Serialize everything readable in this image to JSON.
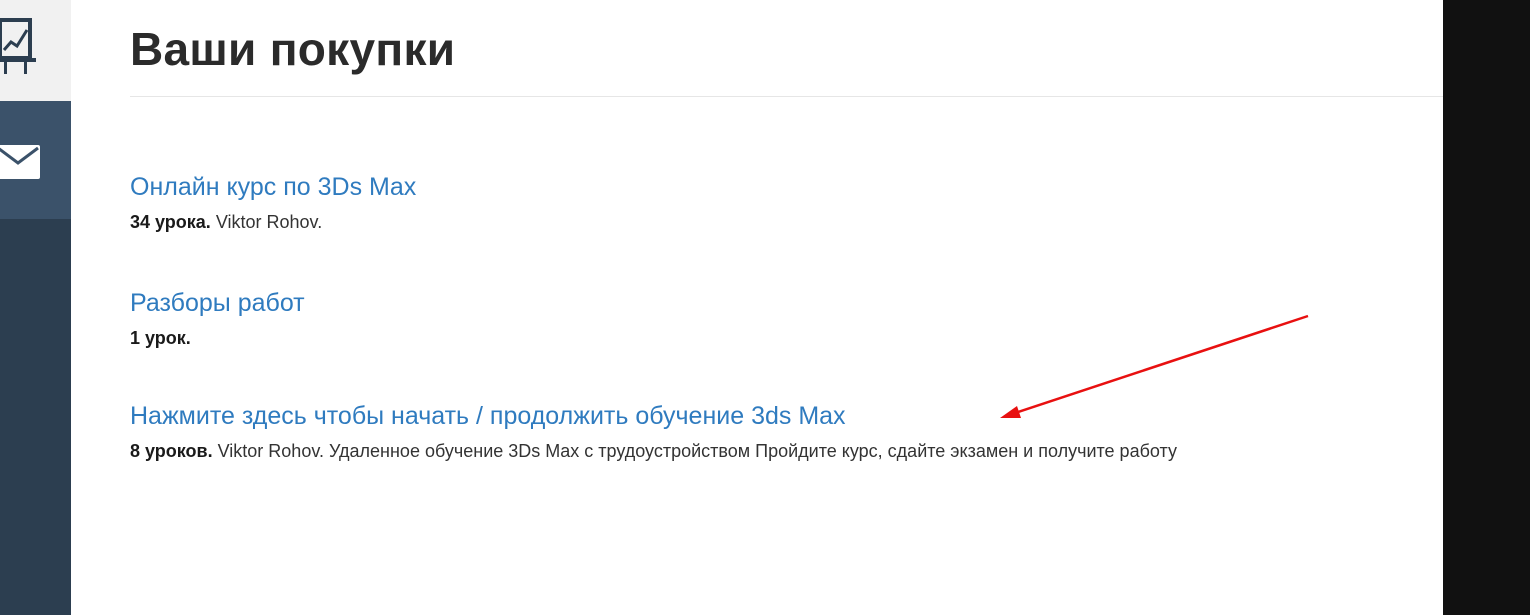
{
  "sidebar": {
    "items": [
      {
        "icon": "chart-board-icon",
        "active": true
      },
      {
        "icon": "mail-icon",
        "active": false
      }
    ]
  },
  "page": {
    "title": "Ваши покупки"
  },
  "purchases": [
    {
      "title": "Онлайн курс по 3Ds Max",
      "lessons": "34 урока.",
      "details": " Viktor Rohov."
    },
    {
      "title": "Разборы работ",
      "lessons": "1 урок.",
      "details": ""
    },
    {
      "title": "Нажмите здесь чтобы начать / продолжить обучение 3ds Max",
      "lessons": "8 уроков.",
      "details": " Viktor Rohov. Удаленное обучение 3Ds Max с трудоустройством Пройдите курс, сдайте экзамен и получите работу"
    }
  ],
  "colors": {
    "sidebar_bg": "#2c3e50",
    "link": "#2f7bbf",
    "annotation_arrow": "#e81010"
  }
}
